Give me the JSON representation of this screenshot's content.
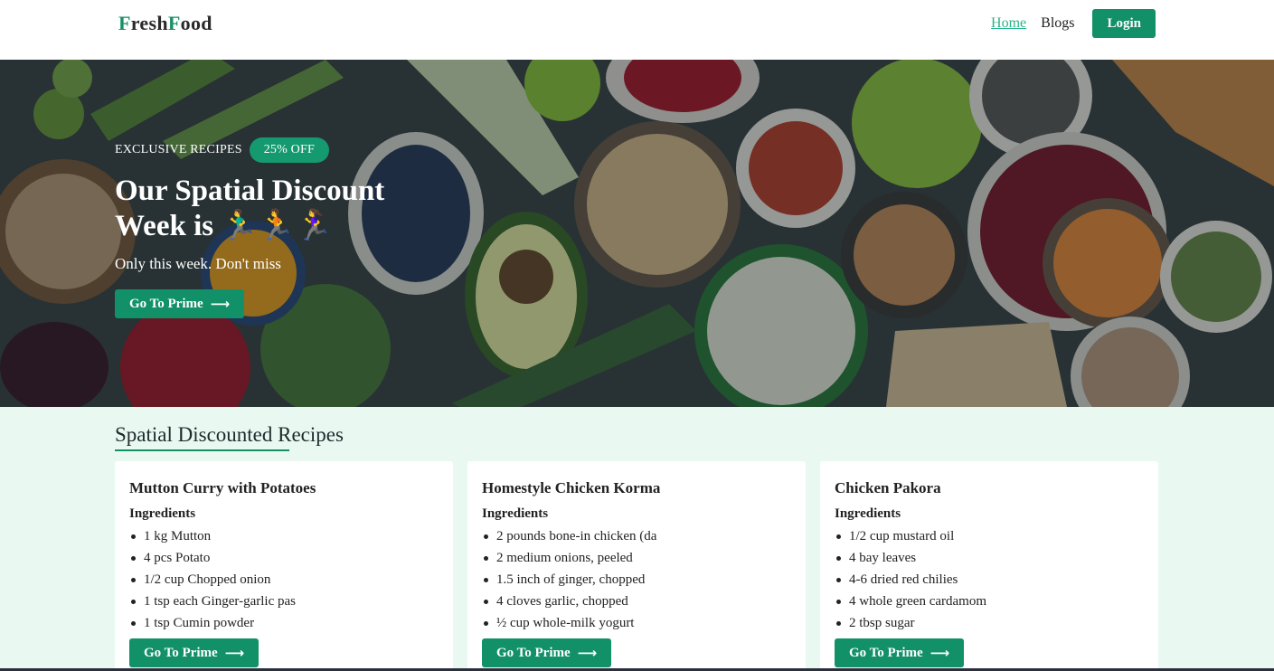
{
  "header": {
    "logo_first_cap": "F",
    "logo_first_rest": "resh",
    "logo_second_cap": "F",
    "logo_second_rest": "ood",
    "nav": [
      {
        "label": "Home",
        "active": true
      },
      {
        "label": "Blogs",
        "active": false
      }
    ],
    "login_label": "Login"
  },
  "hero": {
    "tagline": "EXCLUSIVE RECIPES",
    "badge": "25% OFF",
    "title": "Our Spatial Discount Week is 🏃‍♂️🏃🏃‍♀️",
    "subtitle": "Only this week. Don't miss",
    "cta_label": "Go To Prime",
    "cta_icon": "arrow-right-icon"
  },
  "section": {
    "title": "Spatial Discounted Recipes"
  },
  "recipes": [
    {
      "title": "Mutton Curry with Potatoes",
      "ingredients_label": "Ingredients",
      "ingredients": [
        "1 kg Mutton",
        "4 pcs Potato",
        "1/2 cup Chopped onion",
        "1 tsp each Ginger-garlic pas",
        "1 tsp Cumin powder"
      ],
      "cta_label": "Go To Prime"
    },
    {
      "title": "Homestyle Chicken Korma",
      "ingredients_label": "Ingredients",
      "ingredients": [
        "2 pounds bone-in chicken (da",
        "2 medium onions, peeled",
        "1.5 inch of ginger, chopped",
        "4 cloves garlic, chopped",
        "½ cup whole-milk yogurt"
      ],
      "cta_label": "Go To Prime"
    },
    {
      "title": "Chicken Pakora",
      "ingredients_label": "Ingredients",
      "ingredients": [
        "1/2 cup mustard oil",
        "4 bay leaves",
        "4-6 dried red chilies",
        "4 whole green cardamom",
        "2 tbsp sugar"
      ],
      "cta_label": "Go To Prime"
    }
  ],
  "colors": {
    "brand": "#129068",
    "nav_active": "#2bb38a",
    "section_bg": "#e9f9f2"
  }
}
